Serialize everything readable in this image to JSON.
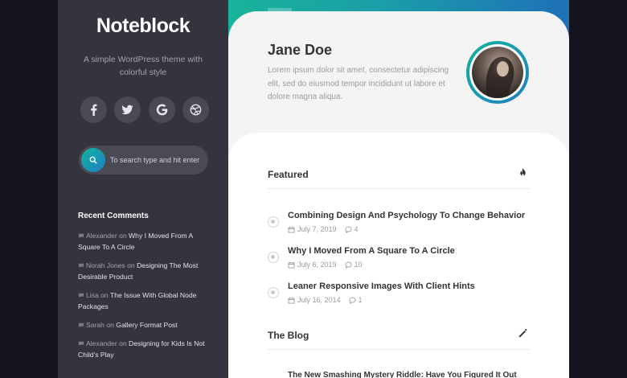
{
  "sidebar": {
    "site_title": "Noteblock",
    "site_description": "A simple WordPress theme with colorful style",
    "socials": [
      {
        "icon": "facebook-icon"
      },
      {
        "icon": "twitter-icon"
      },
      {
        "icon": "google-icon"
      },
      {
        "icon": "dribbble-icon"
      }
    ],
    "search": {
      "placeholder": "To search type and hit enter"
    },
    "recent_comments_title": "Recent Comments",
    "comments": [
      {
        "author": "Alexander",
        "on": "on",
        "post": "Why I Moved From A Square To A Circle"
      },
      {
        "author": "Norah Jones",
        "on": "on",
        "post": "Designing The Most Desirable Product"
      },
      {
        "author": "Lisa",
        "on": "on",
        "post": "The Issue With Global Node Packages"
      },
      {
        "author": "Sarah",
        "on": "on",
        "post": "Gallery Format Post"
      },
      {
        "author": "Alexander",
        "on": "on",
        "post": "Designing for Kids Is Not Child's Play"
      }
    ]
  },
  "profile": {
    "name": "Jane Doe",
    "bio": "Lorem ipsum dolor sit amet, consectetur adipiscing elit, sed do eiusmod tempor incididunt ut labore et dolore magna aliqua."
  },
  "featured": {
    "title": "Featured",
    "posts": [
      {
        "title": "Combining Design And Psychology To Change Behavior",
        "date": "July 7, 2019",
        "comments": "4"
      },
      {
        "title": "Why I Moved From A Square To A Circle",
        "date": "July 6, 2019",
        "comments": "10"
      },
      {
        "title": "Leaner Responsive Images With Client Hints",
        "date": "July 16, 2014",
        "comments": "1"
      }
    ]
  },
  "blog": {
    "title": "The Blog",
    "first_post_title": "The New Smashing Mystery Riddle: Have You Figured It Out"
  },
  "colors": {
    "accent_start": "#12b3a0",
    "accent_end": "#1f7fc1",
    "sidebar_bg": "#34343f"
  }
}
